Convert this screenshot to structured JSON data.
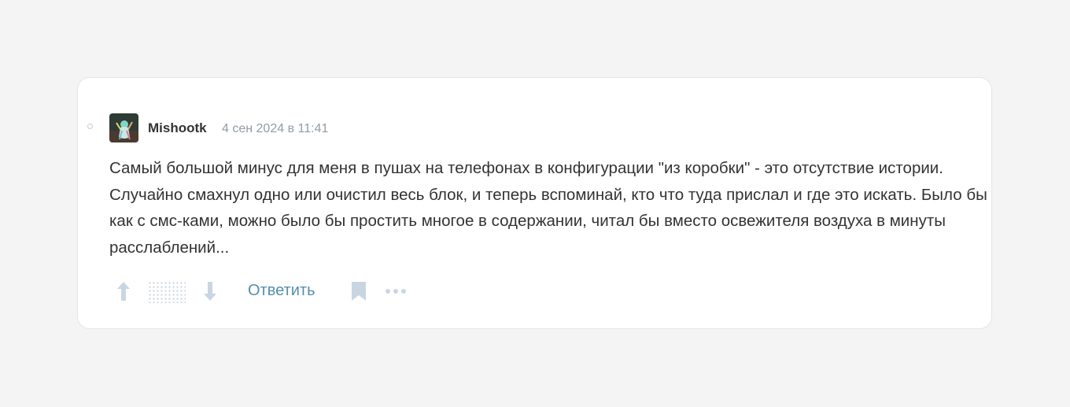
{
  "comment": {
    "author": "Mishootk",
    "timestamp": "4 сен 2024 в 11:41",
    "text": "Самый большой минус для меня в пушах на телефонах в конфигурации \"из коробки\" - это отсутствие истории. Случайно смахнул одно или очистил весь блок, и теперь вспоминай, кто что туда прислал и где это искать. Было бы как с смс-ками, можно было бы простить многое в содержании, читал бы вместо освежителя воздуха в минуты расслаблений...",
    "actions": {
      "reply_label": "Ответить",
      "upvote_icon": "arrow-up-icon",
      "downvote_icon": "arrow-down-icon",
      "bookmark_icon": "bookmark-icon",
      "more_icon": "more-dots-icon"
    }
  },
  "colors": {
    "page_background": "#f4f4f5",
    "card_background": "#ffffff",
    "text": "#333333",
    "meta_text": "#929ca5",
    "link": "#548eaa",
    "icon": "#c9d6e2"
  }
}
